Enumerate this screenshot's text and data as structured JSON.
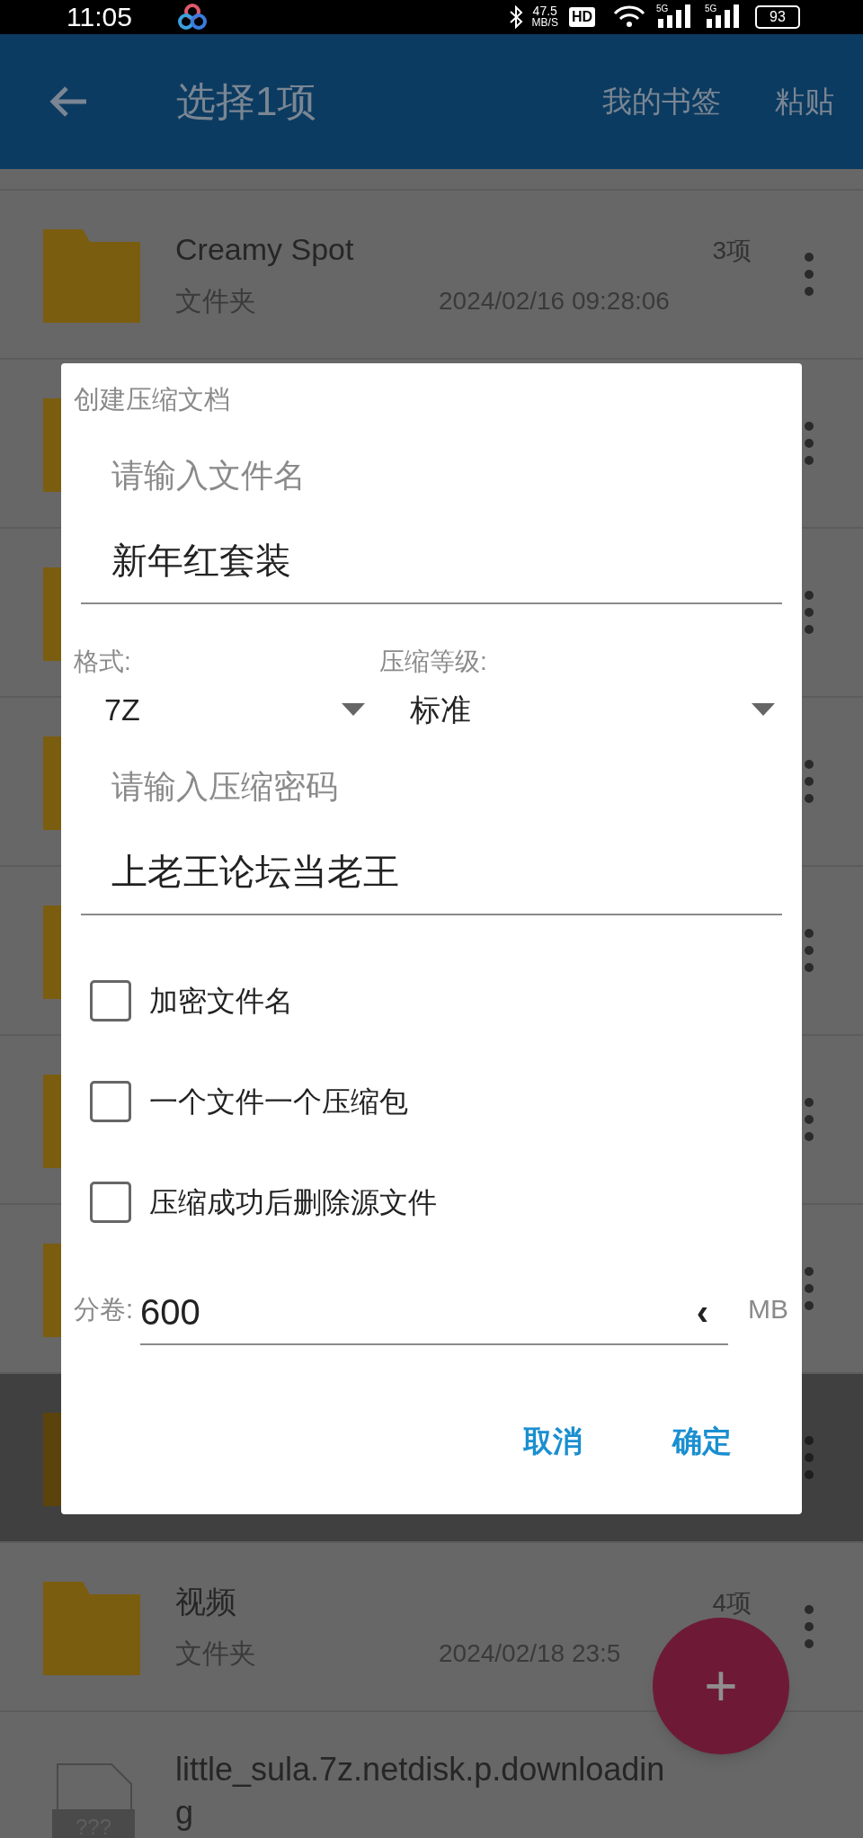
{
  "status_bar": {
    "time": "11:05",
    "speed": "47.5",
    "speed_unit": "MB/S",
    "hd": "HD",
    "networks": [
      "5G",
      "5G"
    ],
    "battery": "93"
  },
  "app_bar": {
    "title": "选择1项",
    "actions": [
      "我的书签",
      "粘贴"
    ]
  },
  "files": [
    {
      "kind": "folder",
      "selected": false,
      "name": "Creamy Spot",
      "type_label": "文件夹",
      "count": "3项",
      "date": "2024/02/16 09:28:06"
    },
    {
      "kind": "folder",
      "selected": false
    },
    {
      "kind": "folder",
      "selected": false
    },
    {
      "kind": "folder",
      "selected": false
    },
    {
      "kind": "folder",
      "selected": false
    },
    {
      "kind": "folder",
      "selected": false
    },
    {
      "kind": "folder",
      "selected": false
    },
    {
      "kind": "folder",
      "selected": true
    },
    {
      "kind": "folder",
      "selected": false,
      "name": "视频",
      "type_label": "文件夹",
      "count": "4项",
      "date": "2024/02/18 23:5"
    },
    {
      "kind": "file",
      "name": "little_sula.7z.netdisk.p.downloading",
      "icon_label": "???"
    }
  ],
  "dialog": {
    "title": "创建压缩文档",
    "name_field": {
      "label": "请输入文件名",
      "value": "新年红套装"
    },
    "selects": [
      {
        "label": "格式:",
        "value": "7Z"
      },
      {
        "label": "压缩等级:",
        "value": "标准"
      }
    ],
    "password_field": {
      "label": "请输入压缩密码",
      "value": "上老王论坛当老王"
    },
    "checkboxes": [
      {
        "label": "加密文件名",
        "checked": false
      },
      {
        "label": "一个文件一个压缩包",
        "checked": false
      },
      {
        "label": "压缩成功后删除源文件",
        "checked": false
      }
    ],
    "split": {
      "label": "分卷:",
      "value": "600",
      "arrow": "‹",
      "unit": "MB"
    },
    "buttons": [
      "取消",
      "确定"
    ]
  },
  "fab": {
    "symbol": "+"
  }
}
